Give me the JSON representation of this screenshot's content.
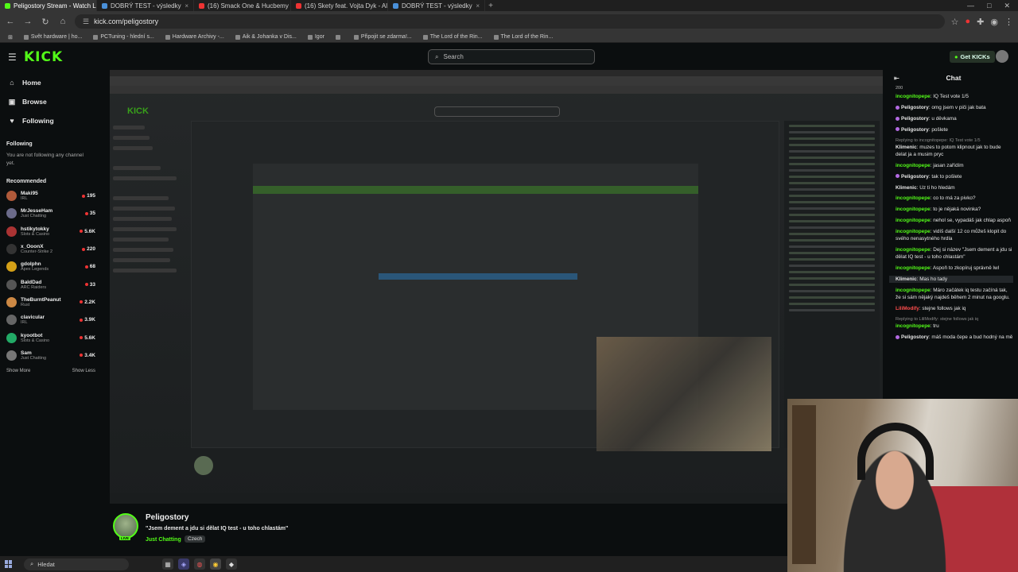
{
  "browser": {
    "tabs": [
      {
        "title": "Peligostory Stream - Watch Live",
        "active": true,
        "color": "#53fc18"
      },
      {
        "title": "DOBRÝ TEST - výsledky",
        "active": false,
        "color": "#4a90d9"
      },
      {
        "title": "(16) Smack One & Hucbemy -",
        "active": false,
        "color": "#e33"
      },
      {
        "title": "(16) Skety feat. Vojta Dyk - Alk",
        "active": false,
        "color": "#e33"
      },
      {
        "title": "DOBRÝ TEST - výsledky",
        "active": false,
        "color": "#4a90d9"
      }
    ],
    "url": "kick.com/peligostory",
    "bookmarks": [
      "Svět hardware | ho...",
      "PCTuning - hlední s...",
      "Hardware Archivy -...",
      "Aik & Johanka v Dis...",
      "Igor",
      "",
      "Připojit se zdarma!...",
      "The Lord of the Rin...",
      "The Lord of the Rin..."
    ]
  },
  "header": {
    "logo": "KICK",
    "search_placeholder": "Search",
    "get_kicks": "Get KICKs"
  },
  "sidebar": {
    "nav": [
      {
        "label": "Home",
        "icon": "home-icon",
        "glyph": "⌂"
      },
      {
        "label": "Browse",
        "icon": "compass-icon",
        "glyph": "▣"
      },
      {
        "label": "Following",
        "icon": "heart-icon",
        "glyph": "♥"
      }
    ],
    "following_title": "Following",
    "following_empty": "You are not following any channel yet.",
    "recommended_title": "Recommended",
    "recommended": [
      {
        "name": "Maki95",
        "category": "IRL",
        "viewers": "195",
        "color": "#b05a3a"
      },
      {
        "name": "MrJesseHam",
        "category": "Just Chatting",
        "viewers": "35",
        "color": "#6b6b8a"
      },
      {
        "name": "hstikytokky",
        "category": "Slots & Casino",
        "viewers": "5.6K",
        "color": "#a33"
      },
      {
        "name": "x_OoonX",
        "category": "Counter-Strike 2",
        "viewers": "220",
        "color": "#333"
      },
      {
        "name": "gdolphn",
        "category": "Apex Legends",
        "viewers": "68",
        "color": "#d4a017"
      },
      {
        "name": "BaldDad",
        "category": "ARC Raiders",
        "viewers": "33",
        "color": "#555"
      },
      {
        "name": "TheBurntPeanut",
        "category": "Rust",
        "viewers": "2.2K",
        "color": "#c84"
      },
      {
        "name": "clavicular",
        "category": "IRL",
        "viewers": "3.9K",
        "color": "#666"
      },
      {
        "name": "kyootbot",
        "category": "Slots & Casino",
        "viewers": "5.6K",
        "color": "#2a6"
      },
      {
        "name": "Sam",
        "category": "Just Chatting",
        "viewers": "3.4K",
        "color": "#777"
      }
    ],
    "show_more": "Show More",
    "show_less": "Show Less"
  },
  "chat": {
    "title": "Chat",
    "top_fragment": "200",
    "messages": [
      {
        "user": "incognitopepe",
        "color": "#53fc18",
        "text": "IQ Test vote 1/5",
        "badge": false,
        "reply": ""
      },
      {
        "user": "Peligostory",
        "color": "#e6e6e6",
        "text": "omg jsem v piči jak bata",
        "badge": true,
        "reply": ""
      },
      {
        "user": "Peligostory",
        "color": "#e6e6e6",
        "text": "u děvkama",
        "badge": true,
        "reply": ""
      },
      {
        "user": "Peligostory",
        "color": "#e6e6e6",
        "text": "pošlete",
        "badge": true,
        "reply": ""
      },
      {
        "user": "Klimenic",
        "color": "#e6e6e6",
        "text": "muzes to potom klipnout jak to bude delat ja a musim pryc",
        "badge": false,
        "reply": "Replying to incognitopepe: IQ Test vote 1/5"
      },
      {
        "user": "incognitopepe",
        "color": "#53fc18",
        "text": "jasan zařídím",
        "badge": false,
        "reply": ""
      },
      {
        "user": "Peligostory",
        "color": "#e6e6e6",
        "text": "tak to pošlete",
        "badge": true,
        "reply": ""
      },
      {
        "user": "Klimenic",
        "color": "#e6e6e6",
        "text": "Uz ti ho hledám",
        "badge": false,
        "reply": ""
      },
      {
        "user": "incognitopepe",
        "color": "#53fc18",
        "text": "co to má za pivko?",
        "badge": false,
        "reply": ""
      },
      {
        "user": "incognitopepe",
        "color": "#53fc18",
        "text": "to je nějaká novinka?",
        "badge": false,
        "reply": ""
      },
      {
        "user": "incognitopepe",
        "color": "#53fc18",
        "text": "nehol se, vypadáš jak chlap aspoň",
        "badge": false,
        "reply": ""
      },
      {
        "user": "incognitopepe",
        "color": "#53fc18",
        "text": "vidíš další 12 co můžeš klopit do svého nenasytného hrdla",
        "badge": false,
        "reply": ""
      },
      {
        "user": "incognitopepe",
        "color": "#53fc18",
        "text": "Dej si název \"Jsem dement a jdu si dělat IQ test - u toho chlastám\"",
        "badge": false,
        "reply": ""
      },
      {
        "user": "incognitopepe",
        "color": "#53fc18",
        "text": "Aspoň to zkopíruj správně lwl",
        "badge": false,
        "reply": ""
      },
      {
        "user": "Klimenic",
        "color": "#e6e6e6",
        "text": "Mas ho tady",
        "badge": false,
        "reply": "",
        "highlight": true
      },
      {
        "user": "incognitopepe",
        "color": "#53fc18",
        "text": "Máro začátek iq testu začíná tak, že si sám nějaký najdeš během 2 minut na googlu.",
        "badge": false,
        "reply": ""
      },
      {
        "user": "LiliModify",
        "color": "#ff4d4d",
        "text": "stejne follows jak iq",
        "badge": false,
        "reply": ""
      },
      {
        "user": "incognitopepe",
        "color": "#53fc18",
        "text": "tru",
        "badge": false,
        "reply": "Replying to LiliModify: stejne follows jak iq"
      },
      {
        "user": "Peligostory",
        "color": "#e6e6e6",
        "text": "máš moda čepe a bud hodný na mě",
        "badge": true,
        "reply": ""
      }
    ]
  },
  "stream": {
    "streamer": "Peligostory",
    "title": "\"Jsem dement a jdu si dělat IQ test - u toho chlastám\"",
    "category": "Just Chatting",
    "tag": "Czech",
    "live_label": "LIVE"
  },
  "taskbar": {
    "search_placeholder": "Hledat"
  }
}
